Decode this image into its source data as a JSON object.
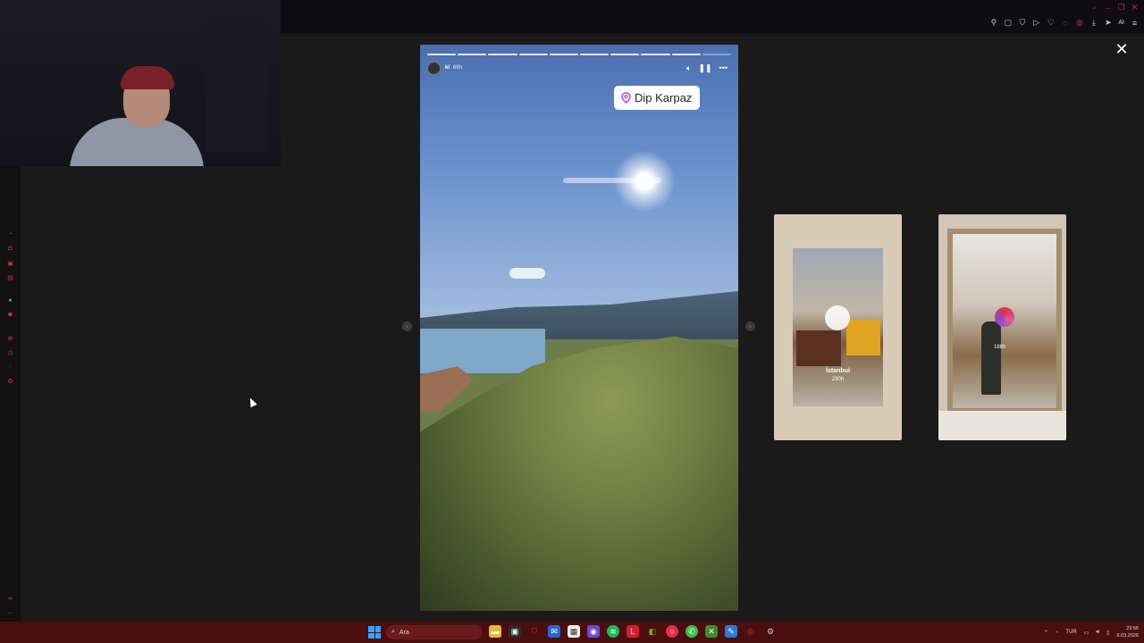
{
  "browser": {
    "ai_label": "AI"
  },
  "story": {
    "username": "kl",
    "time_ago": "66h",
    "location_sticker": "Dip Karpaz",
    "progress_total": 10,
    "progress_current": 9
  },
  "previews": [
    {
      "location": "İstanbul",
      "time_ago": "230h"
    },
    {
      "time_ago": "188h"
    }
  ],
  "taskbar": {
    "search_placeholder": "Ara",
    "language": "TUR",
    "time": "23:56",
    "date": "6.03.2026"
  },
  "colors": {
    "accent": "#e0304a",
    "taskbar_bg": "#4a0e0e",
    "background": "#1a1a1a"
  }
}
